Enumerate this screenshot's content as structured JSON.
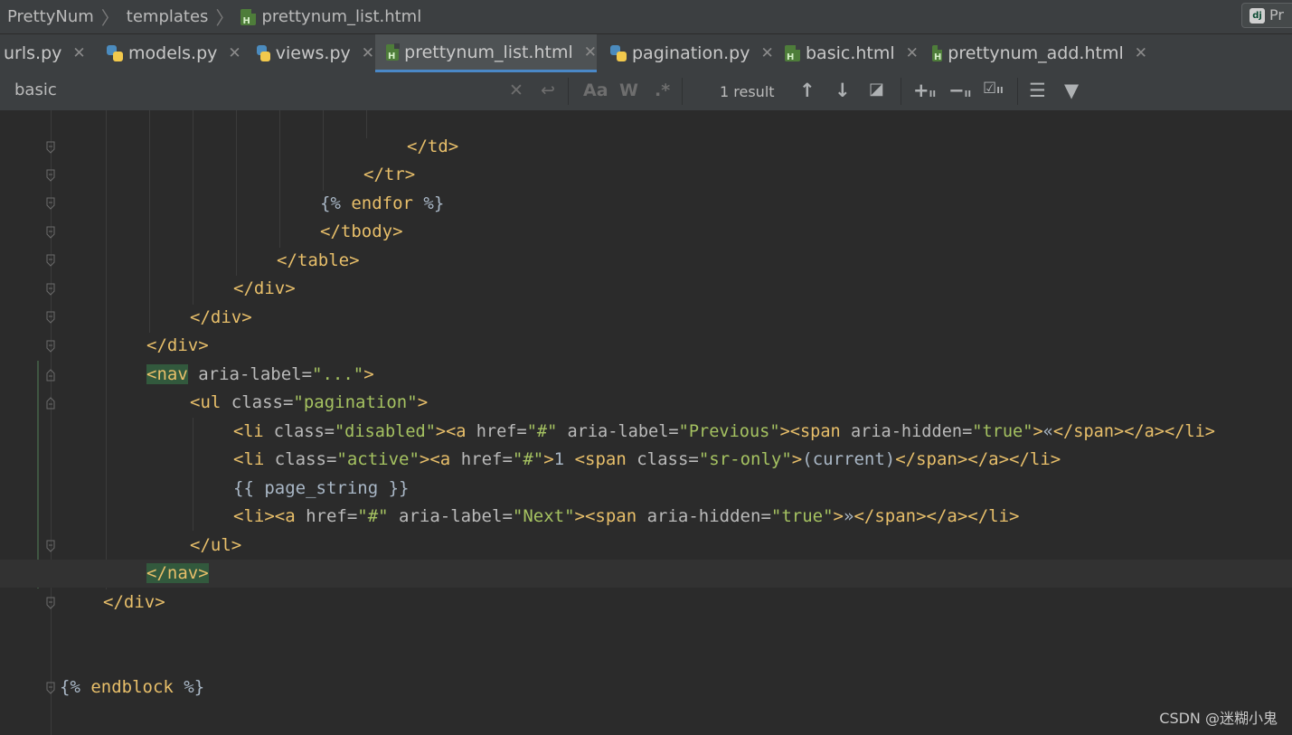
{
  "breadcrumb": {
    "project": "PrettyNum",
    "folder": "templates",
    "file": "prettynum_list.html"
  },
  "run_config": {
    "label": "Pr",
    "icon": "django-icon"
  },
  "tabs": [
    {
      "label": "urls.py",
      "icon": "python-file-icon"
    },
    {
      "label": "models.py",
      "icon": "python-file-icon"
    },
    {
      "label": "views.py",
      "icon": "python-file-icon"
    },
    {
      "label": "prettynum_list.html",
      "icon": "html-file-icon",
      "active": true
    },
    {
      "label": "pagination.py",
      "icon": "python-file-icon"
    },
    {
      "label": "basic.html",
      "icon": "html-file-icon"
    },
    {
      "label": "prettynum_add.html",
      "icon": "html-file-icon"
    }
  ],
  "find": {
    "query": "basic",
    "match_case": "Aa",
    "words": "W",
    "regex": ".*",
    "result": "1 result"
  },
  "code": {
    "l1": "</td>",
    "l2": "</tr>",
    "l3a": "{%",
    "l3b": " endfor ",
    "l3c": "%}",
    "l4": "</tbody>",
    "l5": "</table>",
    "l6": "</div>",
    "l7": "</div>",
    "l8": "</div>",
    "l9a": "<nav",
    "l9b": " aria-label=",
    "l9c": "\"...\"",
    "l9d": ">",
    "l10a": "<ul",
    "l10b": " class=",
    "l10c": "\"pagination\"",
    "l10d": ">",
    "l11a": "<li",
    "l11b": " class=",
    "l11c": "\"disabled\"",
    "l11d": "><a",
    "l11e": " href=",
    "l11f": "\"#\"",
    "l11g": " aria-label=",
    "l11h": "\"Previous\"",
    "l11i": "><span",
    "l11j": " aria-hidden=",
    "l11k": "\"true\"",
    "l11l": ">",
    "l11m": "«",
    "l11n": "</span></a></li>",
    "l12a": "<li",
    "l12b": " class=",
    "l12c": "\"active\"",
    "l12d": "><a",
    "l12e": " href=",
    "l12f": "\"#\"",
    "l12g": ">",
    "l12h": "1 ",
    "l12i": "<span",
    "l12j": " class=",
    "l12k": "\"sr-only\"",
    "l12l": ">",
    "l12m": "(current)",
    "l12n": "</span></a></li>",
    "l13": "{{ page_string }}",
    "l14a": "<li><a",
    "l14b": " href=",
    "l14c": "\"#\"",
    "l14d": " aria-label=",
    "l14e": "\"Next\"",
    "l14f": "><span",
    "l14g": " aria-hidden=",
    "l14h": "\"true\"",
    "l14i": ">",
    "l14j": "»",
    "l14k": "</span></a></li>",
    "l15": "</ul>",
    "l16": "</nav>",
    "l17": "</div>",
    "l18a": "{%",
    "l18b": " endblock ",
    "l18c": "%}"
  },
  "watermark": "CSDN @迷糊小鬼",
  "colors": {
    "tag": "#e8bf6a",
    "string": "#a5c261",
    "attribute": "#bababa",
    "accent": "#4a88c7"
  }
}
